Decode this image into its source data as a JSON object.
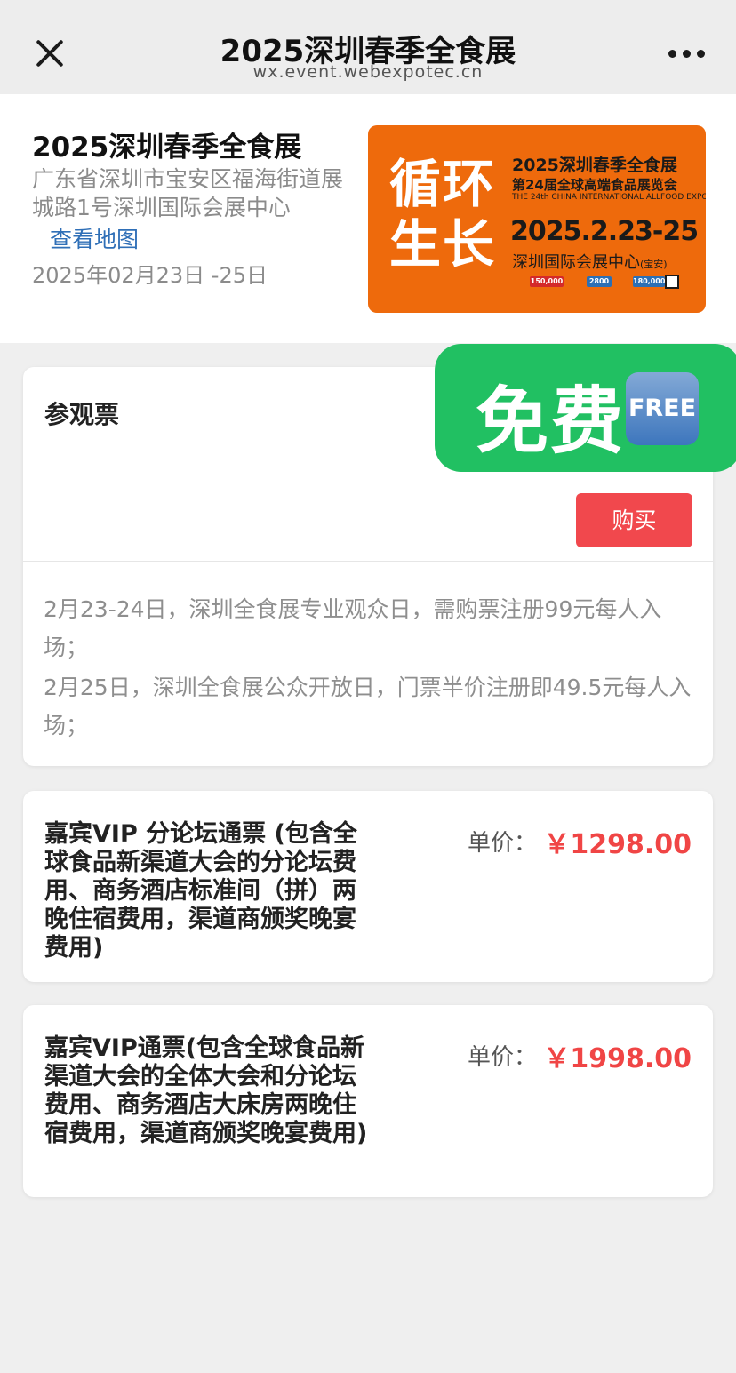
{
  "topbar": {
    "title": "2025深圳春季全食展",
    "url": "wx.event.webexpotec.cn"
  },
  "event": {
    "title": "2025深圳春季全食展",
    "address": "广东省深圳市宝安区福海街道展城路1号深圳国际会展中心",
    "map_link": "查看地图",
    "date": "2025年02月23日 -25日"
  },
  "banner": {
    "slogan_line1": "循环",
    "slogan_line2": "生长",
    "event_name": "2025深圳春季全食展",
    "edition": "第24届全球高端食品展览会",
    "english": "THE 24th CHINA INTERNATIONAL ALLFOOD EXPO",
    "dates": "2025.2.23-25",
    "venue": "深圳国际会展中心",
    "venue_note": "(宝安)",
    "stats": [
      "150,000",
      "2800",
      "180,000"
    ],
    "color": "#ee6a0c"
  },
  "ticket_card": {
    "title": "参观票",
    "buy_label": "购买",
    "notes": [
      "2月23-24日，深圳全食展专业观众日，需购票注册99元每人入场；",
      "2月25日，深圳全食展公众开放日，门票半价注册即49.5元每人入场；"
    ]
  },
  "price_cards": [
    {
      "name": "嘉宾VIP 分论坛通票 (包含全球食品新渠道大会的分论坛费用、商务酒店标准间（拼）两晚住宿费用，渠道商颁奖晚宴费用)",
      "label": "单价：",
      "price": "￥1298.00"
    },
    {
      "name": "嘉宾VIP通票(包含全球食品新渠道大会的全体大会和分论坛费用、商务酒店大床房两晚住宿费用，渠道商颁奖晚宴费用)",
      "label": "单价：",
      "price": "￥1998.00"
    }
  ],
  "free_badge": {
    "text": "免费",
    "icon_text": "FREE",
    "color": "#21c062"
  },
  "icons": [
    "close-icon",
    "more-icon"
  ]
}
